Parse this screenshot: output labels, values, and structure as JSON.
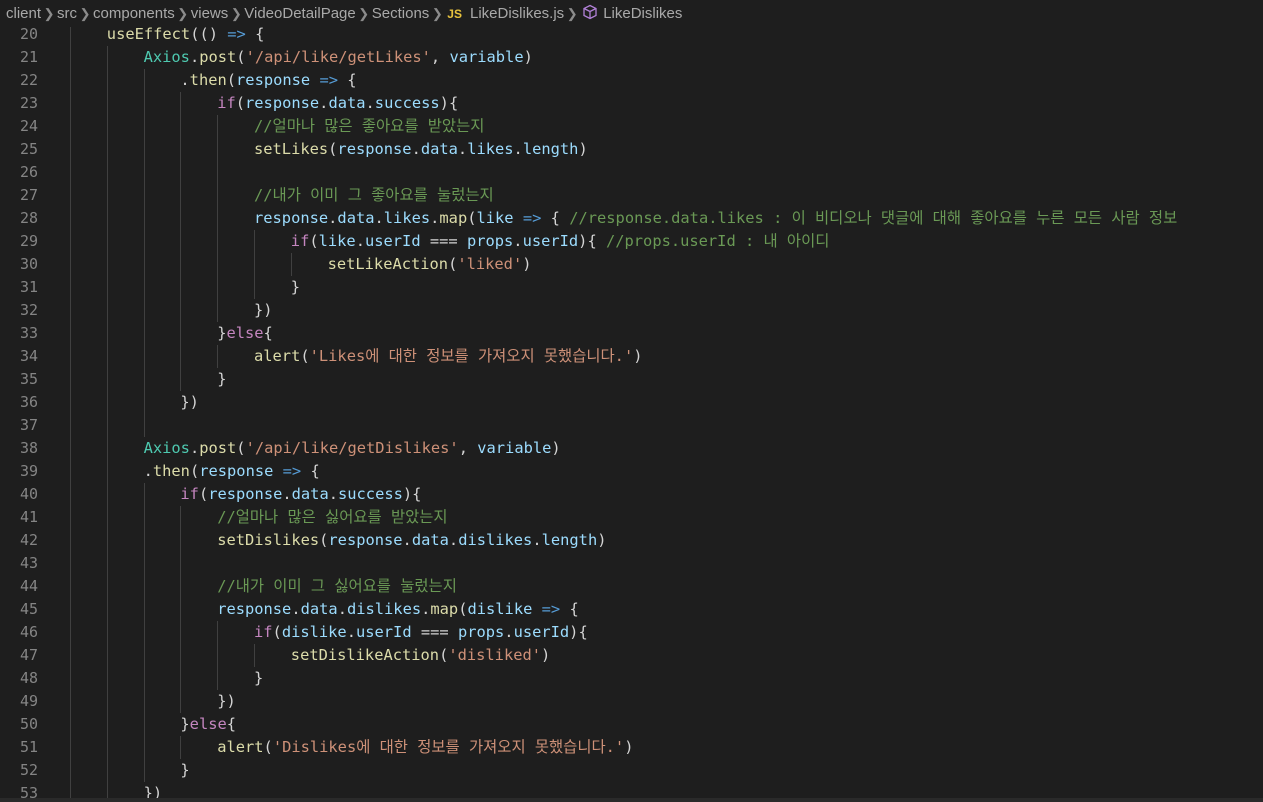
{
  "breadcrumb": {
    "items": [
      "client",
      "src",
      "components",
      "views",
      "VideoDetailPage",
      "Sections"
    ],
    "file_icon": "JS",
    "file_name": "LikeDislikes.js",
    "symbol_icon": "symbol-class-icon",
    "symbol_name": "LikeDislikes"
  },
  "editor": {
    "language": "javascript",
    "first_line_number": 20,
    "lines": [
      {
        "n": "20",
        "indent": 1,
        "tokens": [
          [
            "f",
            "useEffect"
          ],
          [
            "p",
            "(() "
          ],
          [
            "k",
            "=>"
          ],
          [
            "p",
            " {"
          ]
        ]
      },
      {
        "n": "21",
        "indent": 2,
        "tokens": [
          [
            "c",
            "Axios"
          ],
          [
            "p",
            "."
          ],
          [
            "f",
            "post"
          ],
          [
            "p",
            "("
          ],
          [
            "s",
            "'/api/like/getLikes'"
          ],
          [
            "p",
            ", "
          ],
          [
            "v",
            "variable"
          ],
          [
            "p",
            ")"
          ]
        ]
      },
      {
        "n": "22",
        "indent": 3,
        "tokens": [
          [
            "p",
            "."
          ],
          [
            "f",
            "then"
          ],
          [
            "p",
            "("
          ],
          [
            "v",
            "response"
          ],
          [
            "p",
            " "
          ],
          [
            "k",
            "=>"
          ],
          [
            "p",
            " {"
          ]
        ]
      },
      {
        "n": "23",
        "indent": 4,
        "tokens": [
          [
            "kc",
            "if"
          ],
          [
            "p",
            "("
          ],
          [
            "v",
            "response"
          ],
          [
            "p",
            "."
          ],
          [
            "v",
            "data"
          ],
          [
            "p",
            "."
          ],
          [
            "v",
            "success"
          ],
          [
            "p",
            "){"
          ]
        ]
      },
      {
        "n": "24",
        "indent": 5,
        "tokens": [
          [
            "cm",
            "//얼마나 많은 좋아요를 받았는지"
          ]
        ]
      },
      {
        "n": "25",
        "indent": 5,
        "tokens": [
          [
            "f",
            "setLikes"
          ],
          [
            "p",
            "("
          ],
          [
            "v",
            "response"
          ],
          [
            "p",
            "."
          ],
          [
            "v",
            "data"
          ],
          [
            "p",
            "."
          ],
          [
            "v",
            "likes"
          ],
          [
            "p",
            "."
          ],
          [
            "v",
            "length"
          ],
          [
            "p",
            ")"
          ]
        ]
      },
      {
        "n": "26",
        "indent": 5,
        "tokens": []
      },
      {
        "n": "27",
        "indent": 5,
        "tokens": [
          [
            "cm",
            "//내가 이미 그 좋아요를 눌렀는지"
          ]
        ]
      },
      {
        "n": "28",
        "indent": 5,
        "tokens": [
          [
            "v",
            "response"
          ],
          [
            "p",
            "."
          ],
          [
            "v",
            "data"
          ],
          [
            "p",
            "."
          ],
          [
            "v",
            "likes"
          ],
          [
            "p",
            "."
          ],
          [
            "f",
            "map"
          ],
          [
            "p",
            "("
          ],
          [
            "v",
            "like"
          ],
          [
            "p",
            " "
          ],
          [
            "k",
            "=>"
          ],
          [
            "p",
            " { "
          ],
          [
            "cm",
            "//response.data.likes : 이 비디오나 댓글에 대해 좋아요를 누른 모든 사람 정보"
          ]
        ]
      },
      {
        "n": "29",
        "indent": 6,
        "tokens": [
          [
            "kc",
            "if"
          ],
          [
            "p",
            "("
          ],
          [
            "v",
            "like"
          ],
          [
            "p",
            "."
          ],
          [
            "v",
            "userId"
          ],
          [
            "p",
            " === "
          ],
          [
            "v",
            "props"
          ],
          [
            "p",
            "."
          ],
          [
            "v",
            "userId"
          ],
          [
            "p",
            "){ "
          ],
          [
            "cm",
            "//props.userId : 내 아이디"
          ]
        ]
      },
      {
        "n": "30",
        "indent": 7,
        "tokens": [
          [
            "f",
            "setLikeAction"
          ],
          [
            "p",
            "("
          ],
          [
            "s",
            "'liked'"
          ],
          [
            "p",
            ")"
          ]
        ]
      },
      {
        "n": "31",
        "indent": 6,
        "tokens": [
          [
            "p",
            "}"
          ]
        ]
      },
      {
        "n": "32",
        "indent": 5,
        "tokens": [
          [
            "p",
            "})"
          ]
        ]
      },
      {
        "n": "33",
        "indent": 4,
        "tokens": [
          [
            "p",
            "}"
          ],
          [
            "kc",
            "else"
          ],
          [
            "p",
            "{"
          ]
        ]
      },
      {
        "n": "34",
        "indent": 5,
        "tokens": [
          [
            "f",
            "alert"
          ],
          [
            "p",
            "("
          ],
          [
            "s",
            "'Likes에 대한 정보를 가져오지 못했습니다.'"
          ],
          [
            "p",
            ")"
          ]
        ]
      },
      {
        "n": "35",
        "indent": 4,
        "tokens": [
          [
            "p",
            "}"
          ]
        ]
      },
      {
        "n": "36",
        "indent": 3,
        "tokens": [
          [
            "p",
            "})"
          ]
        ]
      },
      {
        "n": "37",
        "indent": 3,
        "tokens": []
      },
      {
        "n": "38",
        "indent": 2,
        "tokens": [
          [
            "c",
            "Axios"
          ],
          [
            "p",
            "."
          ],
          [
            "f",
            "post"
          ],
          [
            "p",
            "("
          ],
          [
            "s",
            "'/api/like/getDislikes'"
          ],
          [
            "p",
            ", "
          ],
          [
            "v",
            "variable"
          ],
          [
            "p",
            ")"
          ]
        ]
      },
      {
        "n": "39",
        "indent": 2,
        "tokens": [
          [
            "p",
            "."
          ],
          [
            "f",
            "then"
          ],
          [
            "p",
            "("
          ],
          [
            "v",
            "response"
          ],
          [
            "p",
            " "
          ],
          [
            "k",
            "=>"
          ],
          [
            "p",
            " {"
          ]
        ]
      },
      {
        "n": "40",
        "indent": 3,
        "tokens": [
          [
            "kc",
            "if"
          ],
          [
            "p",
            "("
          ],
          [
            "v",
            "response"
          ],
          [
            "p",
            "."
          ],
          [
            "v",
            "data"
          ],
          [
            "p",
            "."
          ],
          [
            "v",
            "success"
          ],
          [
            "p",
            "){"
          ]
        ]
      },
      {
        "n": "41",
        "indent": 4,
        "tokens": [
          [
            "cm",
            "//얼마나 많은 싫어요를 받았는지"
          ]
        ]
      },
      {
        "n": "42",
        "indent": 4,
        "tokens": [
          [
            "f",
            "setDislikes"
          ],
          [
            "p",
            "("
          ],
          [
            "v",
            "response"
          ],
          [
            "p",
            "."
          ],
          [
            "v",
            "data"
          ],
          [
            "p",
            "."
          ],
          [
            "v",
            "dislikes"
          ],
          [
            "p",
            "."
          ],
          [
            "v",
            "length"
          ],
          [
            "p",
            ")"
          ]
        ]
      },
      {
        "n": "43",
        "indent": 4,
        "tokens": []
      },
      {
        "n": "44",
        "indent": 4,
        "tokens": [
          [
            "cm",
            "//내가 이미 그 싫어요를 눌렀는지"
          ]
        ]
      },
      {
        "n": "45",
        "indent": 4,
        "tokens": [
          [
            "v",
            "response"
          ],
          [
            "p",
            "."
          ],
          [
            "v",
            "data"
          ],
          [
            "p",
            "."
          ],
          [
            "v",
            "dislikes"
          ],
          [
            "p",
            "."
          ],
          [
            "f",
            "map"
          ],
          [
            "p",
            "("
          ],
          [
            "v",
            "dislike"
          ],
          [
            "p",
            " "
          ],
          [
            "k",
            "=>"
          ],
          [
            "p",
            " {"
          ]
        ]
      },
      {
        "n": "46",
        "indent": 5,
        "tokens": [
          [
            "kc",
            "if"
          ],
          [
            "p",
            "("
          ],
          [
            "v",
            "dislike"
          ],
          [
            "p",
            "."
          ],
          [
            "v",
            "userId"
          ],
          [
            "p",
            " === "
          ],
          [
            "v",
            "props"
          ],
          [
            "p",
            "."
          ],
          [
            "v",
            "userId"
          ],
          [
            "p",
            "){"
          ]
        ]
      },
      {
        "n": "47",
        "indent": 6,
        "tokens": [
          [
            "f",
            "setDislikeAction"
          ],
          [
            "p",
            "("
          ],
          [
            "s",
            "'disliked'"
          ],
          [
            "p",
            ")"
          ]
        ]
      },
      {
        "n": "48",
        "indent": 5,
        "tokens": [
          [
            "p",
            "}"
          ]
        ]
      },
      {
        "n": "49",
        "indent": 4,
        "tokens": [
          [
            "p",
            "})"
          ]
        ]
      },
      {
        "n": "50",
        "indent": 3,
        "tokens": [
          [
            "p",
            "}"
          ],
          [
            "kc",
            "else"
          ],
          [
            "p",
            "{"
          ]
        ]
      },
      {
        "n": "51",
        "indent": 4,
        "tokens": [
          [
            "f",
            "alert"
          ],
          [
            "p",
            "("
          ],
          [
            "s",
            "'Dislikes에 대한 정보를 가져오지 못했습니다.'"
          ],
          [
            "p",
            ")"
          ]
        ]
      },
      {
        "n": "52",
        "indent": 3,
        "tokens": [
          [
            "p",
            "}"
          ]
        ]
      },
      {
        "n": "53",
        "indent": 2,
        "tokens": [
          [
            "p",
            "})"
          ]
        ]
      }
    ]
  }
}
